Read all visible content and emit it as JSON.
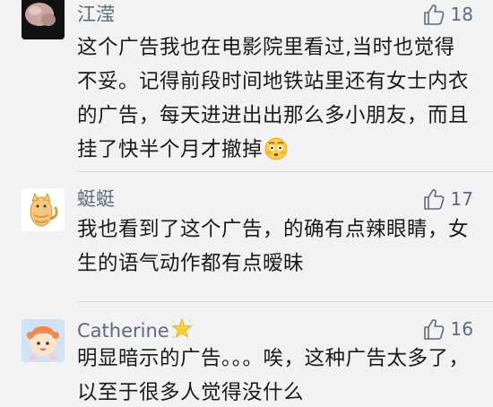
{
  "comments": [
    {
      "username": "江滢",
      "likes": "18",
      "text": "这个广告我也在电影院里看过,当时也觉得不妥。记得前段时间地铁站里还有女士内衣的广告，每天进进出出那么多小朋友，而且挂了快半个月才撤掉",
      "trailing_icon": "flushed-face-emoji"
    },
    {
      "username": "蜓蜓",
      "likes": "17",
      "text": "我也看到了这个广告，的确有点辣眼睛，女生的语气动作都有点暧昧"
    },
    {
      "username": "Catherine",
      "username_badge": "glowing-star-emoji",
      "likes": "16",
      "text": "明显暗示的广告。。。唉，这种广告太多了，以至于很多人觉得没什么"
    }
  ],
  "colors": {
    "background": "#f2f2f2",
    "username": "#5d6b80",
    "text": "#1a1a1a",
    "divider": "#dcdcdc"
  }
}
